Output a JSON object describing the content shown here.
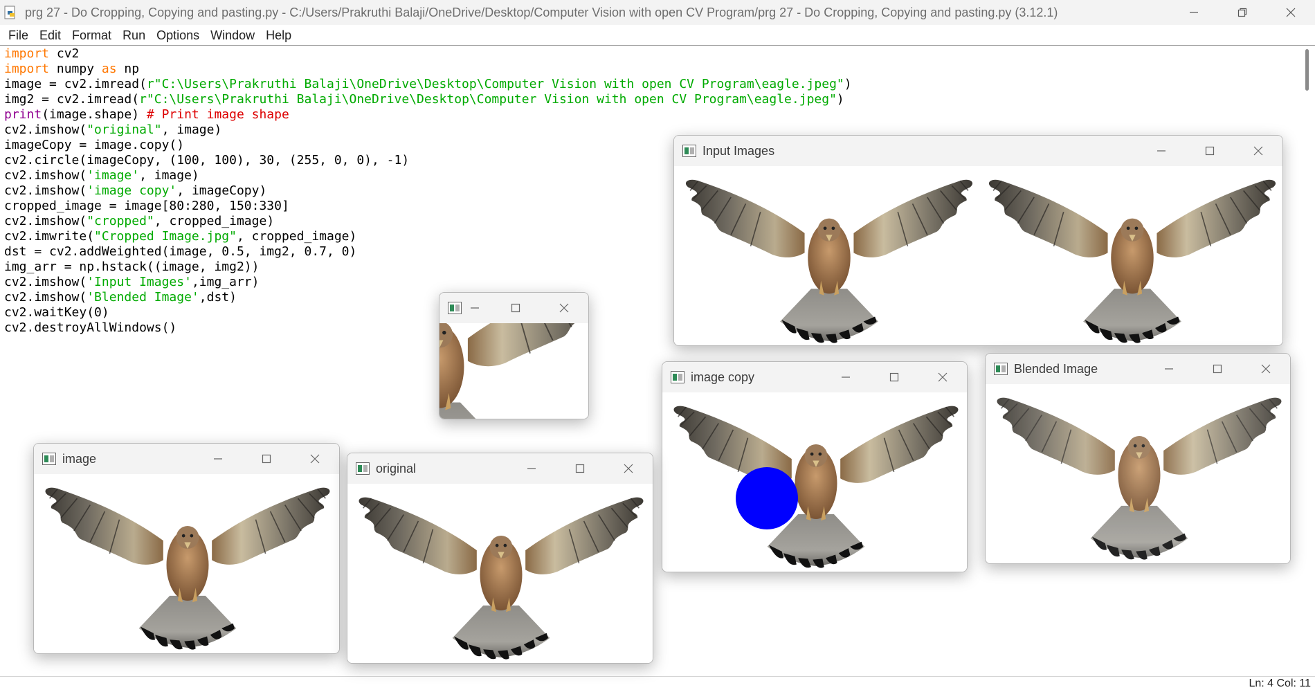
{
  "window": {
    "title": "prg 27 - Do Cropping, Copying and pasting.py - C:/Users/Prakruthi Balaji/OneDrive/Desktop/Computer Vision with open CV Program/prg 27 - Do Cropping, Copying and pasting.py (3.12.1)"
  },
  "menu": [
    "File",
    "Edit",
    "Format",
    "Run",
    "Options",
    "Window",
    "Help"
  ],
  "code_lines": [
    [
      [
        "kw",
        "import"
      ],
      [
        "n",
        " cv2"
      ]
    ],
    [
      [
        "kw",
        "import"
      ],
      [
        "n",
        " numpy "
      ],
      [
        "kw",
        "as"
      ],
      [
        "n",
        " np"
      ]
    ],
    [
      [
        "n",
        "image = cv2.imread("
      ],
      [
        "st",
        "r\"C:\\Users\\Prakruthi Balaji\\OneDrive\\Desktop\\Computer Vision with open CV Program\\eagle.jpeg\""
      ],
      [
        "n",
        ")"
      ]
    ],
    [
      [
        "n",
        "img2 = cv2.imread("
      ],
      [
        "st",
        "r\"C:\\Users\\Prakruthi Balaji\\OneDrive\\Desktop\\Computer Vision with open CV Program\\eagle.jpeg\""
      ],
      [
        "n",
        ")"
      ]
    ],
    [
      [
        "bi",
        "print"
      ],
      [
        "n",
        "(image.shape) "
      ],
      [
        "cm",
        "# Print image shape"
      ]
    ],
    [
      [
        "n",
        "cv2.imshow("
      ],
      [
        "st",
        "\"original\""
      ],
      [
        "n",
        ", image)"
      ]
    ],
    [
      [
        "n",
        "imageCopy = image.copy()"
      ]
    ],
    [
      [
        "n",
        "cv2.circle(imageCopy, (100, 100), 30, (255, 0, 0), -1)"
      ]
    ],
    [
      [
        "n",
        "cv2.imshow("
      ],
      [
        "st",
        "'image'"
      ],
      [
        "n",
        ", image)"
      ]
    ],
    [
      [
        "n",
        "cv2.imshow("
      ],
      [
        "st",
        "'image copy'"
      ],
      [
        "n",
        ", imageCopy)"
      ]
    ],
    [
      [
        "n",
        "cropped_image = image[80:280, 150:330]"
      ]
    ],
    [
      [
        "n",
        "cv2.imshow("
      ],
      [
        "st",
        "\"cropped\""
      ],
      [
        "n",
        ", cropped_image)"
      ]
    ],
    [
      [
        "n",
        "cv2.imwrite("
      ],
      [
        "st",
        "\"Cropped Image.jpg\""
      ],
      [
        "n",
        ", cropped_image)"
      ]
    ],
    [
      [
        "n",
        "dst = cv2.addWeighted(image, 0.5, img2, 0.7, 0)"
      ]
    ],
    [
      [
        "n",
        "img_arr = np.hstack((image, img2))"
      ]
    ],
    [
      [
        "n",
        "cv2.imshow("
      ],
      [
        "st",
        "'Input Images'"
      ],
      [
        "n",
        ",img_arr)"
      ]
    ],
    [
      [
        "n",
        "cv2.imshow("
      ],
      [
        "st",
        "'Blended Image'"
      ],
      [
        "n",
        ",dst)"
      ]
    ],
    [
      [
        "n",
        "cv2.waitKey(0)"
      ]
    ],
    [
      [
        "n",
        "cv2.destroyAllWindows()"
      ]
    ]
  ],
  "status": {
    "position": "Ln: 4   Col: 11"
  },
  "cv_windows": {
    "input_images": {
      "title": "Input Images"
    },
    "cropped": {
      "title": ""
    },
    "image_copy": {
      "title": "image copy"
    },
    "blended": {
      "title": "Blended Image"
    },
    "image": {
      "title": "image"
    },
    "original": {
      "title": "original"
    }
  },
  "colors": {
    "keyword": "#ff7700",
    "builtin": "#900090",
    "string": "#00aa00",
    "comment": "#dd0000",
    "drawn_circle": "#0000ff"
  },
  "icons": [
    "python-file-icon",
    "minimize-icon",
    "restore-icon",
    "close-icon",
    "opencv-window-icon",
    "maximize-icon"
  ]
}
